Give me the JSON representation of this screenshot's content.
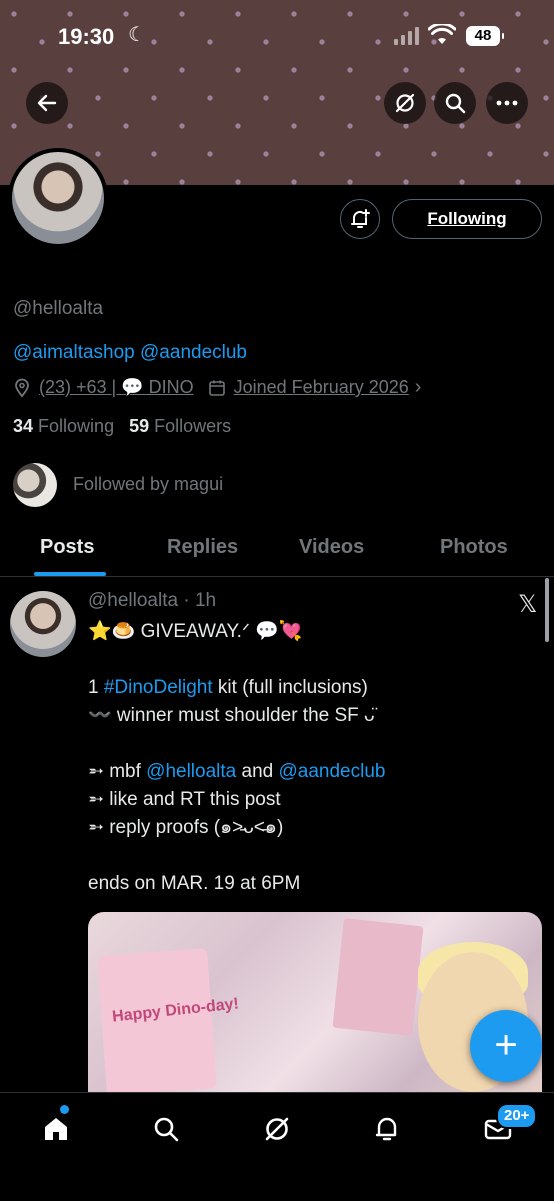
{
  "status_bar": {
    "time": "19:30",
    "battery": "48"
  },
  "profile": {
    "handle": "@helloalta",
    "bio": "@aimaltashop @aandeclub",
    "location": "(23) +63 | 💬 DINO",
    "joined": "Joined February 2026",
    "following_count": "34",
    "following_label": "Following",
    "followers_count": "59",
    "followers_label": "Followers",
    "followed_by": "Followed by magui",
    "follow_button": "Following"
  },
  "tabs": [
    "Posts",
    "Replies",
    "Videos",
    "Photos"
  ],
  "post": {
    "header": "@helloalta · 1h",
    "line1": "⭐️🍮 GIVEAWAY.ᐟ 💬💘",
    "line2_pre": "1 ",
    "line2_tag": "#DinoDelight",
    "line2_post": " kit (full inclusions)",
    "line3": "〰️ winner must shoulder the SF ᴗ̈",
    "line4_pre": "➵ mbf ",
    "line4_link1": "@helloalta",
    "line4_mid": " and ",
    "line4_link2": "@aandeclub",
    "line5": "➵ like and RT this post",
    "line6": "➵ reply proofs (๑˃̵ᴗ˂̵๑)",
    "line7": "ends on MAR. 19 at 6PM",
    "media_text": "Happy Dino-day!"
  },
  "nav": {
    "badge": "20+"
  },
  "colors": {
    "accent": "#1d9bf0",
    "background": "#000000",
    "muted": "#71767b"
  }
}
